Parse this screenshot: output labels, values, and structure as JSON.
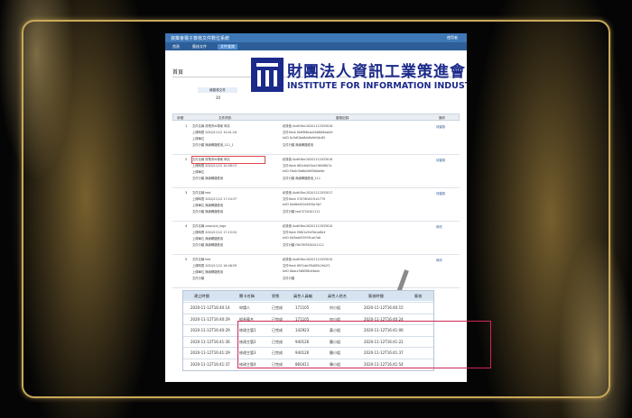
{
  "window": {
    "title": "資策會電子簽核文件數位系統",
    "user": "使用者"
  },
  "nav": {
    "items": [
      "首頁",
      "簽核文件",
      "文件查詢"
    ]
  },
  "breadcrumb": "首頁",
  "logo": {
    "zh": "財團法人資訊工業策進會",
    "en": "INSTITUTE FOR INFORMATION INDUSTRY"
  },
  "stats": {
    "label": "總簽核文件",
    "value": "20"
  },
  "table1": {
    "headers": [
      "序號",
      "文件資訊",
      "簽核記錄",
      "操作"
    ],
    "rows": [
      {
        "num": "1",
        "left": [
          "文件名稱  資策會AI專案 申請",
          "上傳時間  2020/11/12 10:01:16",
          "上傳單位  ",
          "文件分類  無線網路應用_111_1"
        ],
        "right": [
          "紀錄值  AuditDoc20201112033016",
          "文件Hash  f0df6f6caa5006d9ea0fe",
          "txID  0c5df1ba6ddfa9e5dc65",
          "文件分類  無線網路應用"
        ],
        "act": "待簽核"
      },
      {
        "num": "2",
        "left": [
          "文件名稱  資策會AI專案 申請",
          "上傳時間  2020/11/12 10:48:13",
          "上傳單位  ",
          "文件分類  無線網路應用"
        ],
        "right": [
          "紀錄值  AuditDoc20201112033016",
          "文件Hash  882c8d03ea7d0f4807a",
          "txID  f3a0c5b6b0e6f3b0afdb",
          "文件分類  無線網路應用_111"
        ],
        "act": "待簽核"
      },
      {
        "num": "3",
        "left": [
          "文件名稱  test",
          "上傳時間  2020/11/12 17:24:37",
          "上傳單位  無線網路應用",
          "文件分類  無線網路應用"
        ],
        "right": [
          "紀錄值  AuditDoc20201112033017",
          "文件Hash  57078fc81f1e1779",
          "txID  0d46a942e9030c3b7",
          "文件分類  test3720201112"
        ],
        "act": "待簽核"
      },
      {
        "num": "4",
        "left": [
          "文件名稱  zzzzz/z/z_logo",
          "上傳時間  2020/11/12 17:15:54",
          "上傳單位  無線網路應用",
          "文件分類  無線網路應用"
        ],
        "right": [
          "紀錄值  AuditDoc20201112033010",
          "文件Hash  f5801e5ef3b1a8b4",
          "txID  0d3aa05593f1ae7ab",
          "文件分類  F8d78f5f20201112"
        ],
        "act": "修改"
      },
      {
        "num": "5",
        "left": [
          "文件名稱  test",
          "上傳時間  2020/11/12 16:46:59",
          "上傳單位  無線網路應用",
          "文件分類  "
        ],
        "right": [
          "紀錄值  AuditDoc20201112033010",
          "文件Hash  6931ab78d0f3c2fa2f1",
          "txID  0bacc5685f8cd4bdc",
          "文件分類  "
        ],
        "act": "修改"
      }
    ]
  },
  "table2": {
    "headers": [
      "建立時間",
      "關卡名稱",
      "狀態",
      "員性人員編",
      "員性人姓名",
      "簽核時間",
      "簽核"
    ],
    "rows": [
      [
        "2020-11-12T16:40:14",
        "申請人",
        "已完成",
        "171105",
        "何小姐",
        "2020-11-12T16:40:15"
      ],
      [
        "2020-11-12T16:40:29",
        "組長簽名",
        "已完成",
        "171105",
        "何小姐",
        "2020-11-12T16:40:24"
      ],
      [
        "2020-11-12T16:40:29",
        "修改主管1",
        "已完成",
        "142923",
        "黃小姐",
        "2020-11-12T16:41:06"
      ],
      [
        "2020-11-12T16:41:36",
        "修改主管2",
        "已完成",
        "940126",
        "簡小姐",
        "2020-11-12T16:41:22"
      ],
      [
        "2020-11-12T16:41:29",
        "修改主管3",
        "已完成",
        "940126",
        "簡小姐",
        "2020-11-12T16:41:37"
      ],
      [
        "2020-11-12T16:41:37",
        "修改主管4",
        "已完成",
        "860411",
        "陳小姐",
        "2020-11-12T16:41:54"
      ]
    ]
  }
}
